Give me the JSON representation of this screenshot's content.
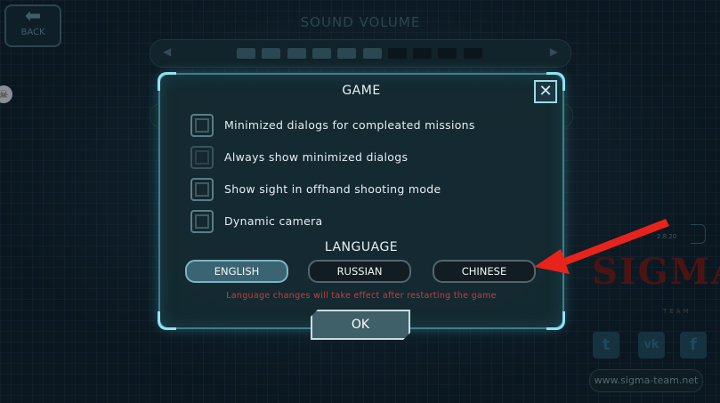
{
  "background": {
    "back_button": {
      "label": "BACK",
      "icon": "back-arrow-icon"
    },
    "sound_volume": {
      "title": "SOUND VOLUME",
      "level": 0.6,
      "segments_total": 10,
      "segments_filled": 6
    },
    "version": "2.8.20",
    "logo_text": "SIGMA",
    "team_text": "TEAM",
    "social": [
      {
        "name": "twitter",
        "glyph": "t",
        "icon": "twitter-icon"
      },
      {
        "name": "vk",
        "glyph": "vk",
        "icon": "vk-icon"
      },
      {
        "name": "facebook",
        "glyph": "f",
        "icon": "facebook-icon"
      }
    ],
    "website": "www.sigma-team.net"
  },
  "dialog": {
    "title": "GAME",
    "close_glyph": "✕",
    "options": [
      {
        "label": "Minimized dialogs for compleated missions",
        "checked": false
      },
      {
        "label": "Always show minimized dialogs",
        "checked": false
      },
      {
        "label": "Show sight in offhand shooting mode",
        "checked": false
      },
      {
        "label": "Dynamic camera",
        "checked": false
      }
    ],
    "language": {
      "title": "LANGUAGE",
      "buttons": [
        {
          "label": "ENGLISH",
          "selected": true
        },
        {
          "label": "RUSSIAN",
          "selected": false
        },
        {
          "label": "CHINESE",
          "selected": false
        }
      ],
      "note": "Language changes will take effect after restarting the game"
    },
    "ok_label": "OK"
  },
  "colors": {
    "accent_cyan": "#8fe4f0",
    "note_red": "#c4403c",
    "arrow_red": "#e8231c",
    "selected_button": "#3a6472"
  }
}
